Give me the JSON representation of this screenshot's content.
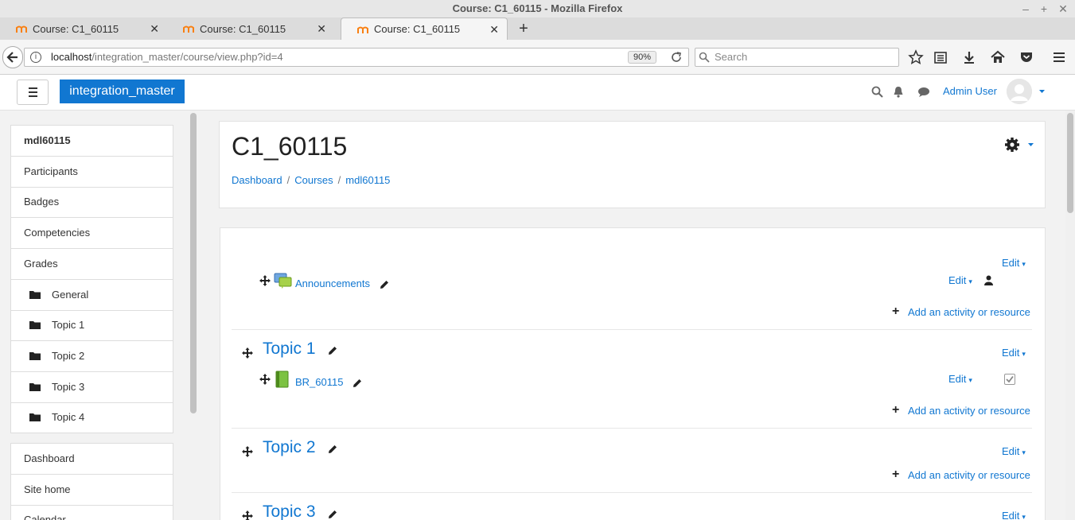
{
  "window": {
    "title": "Course: C1_60115 - Mozilla Firefox"
  },
  "tabs": [
    {
      "label": "Course: C1_60115"
    },
    {
      "label": "Course: C1_60115"
    },
    {
      "label": "Course: C1_60115"
    }
  ],
  "address_bar": {
    "host": "localhost",
    "path": "/integration_master/course/view.php?id=4",
    "zoom": "90%"
  },
  "search": {
    "placeholder": "Search"
  },
  "header": {
    "brand": "integration_master",
    "user_name": "Admin User"
  },
  "drawer": {
    "course_items": [
      {
        "label": "mdl60115"
      },
      {
        "label": "Participants"
      },
      {
        "label": "Badges"
      },
      {
        "label": "Competencies"
      },
      {
        "label": "Grades"
      },
      {
        "label": "General"
      },
      {
        "label": "Topic 1"
      },
      {
        "label": "Topic 2"
      },
      {
        "label": "Topic 3"
      },
      {
        "label": "Topic 4"
      }
    ],
    "site_items": [
      {
        "label": "Dashboard"
      },
      {
        "label": "Site home"
      },
      {
        "label": "Calendar"
      }
    ]
  },
  "page": {
    "title": "C1_60115",
    "breadcrumb": [
      {
        "label": "Dashboard"
      },
      {
        "label": "Courses"
      },
      {
        "label": "mdl60115"
      }
    ],
    "breadcrumb_sep": "/"
  },
  "course": {
    "edit_label": "Edit",
    "add_label": "Add an activity or resource",
    "general": {
      "activity": "Announcements"
    },
    "topic1": {
      "title": "Topic 1",
      "activity": "BR_60115"
    },
    "topic2": {
      "title": "Topic 2"
    },
    "topic3": {
      "title": "Topic 3"
    }
  },
  "colors": {
    "link": "#1177d1",
    "brand_bg": "#1177d1"
  }
}
